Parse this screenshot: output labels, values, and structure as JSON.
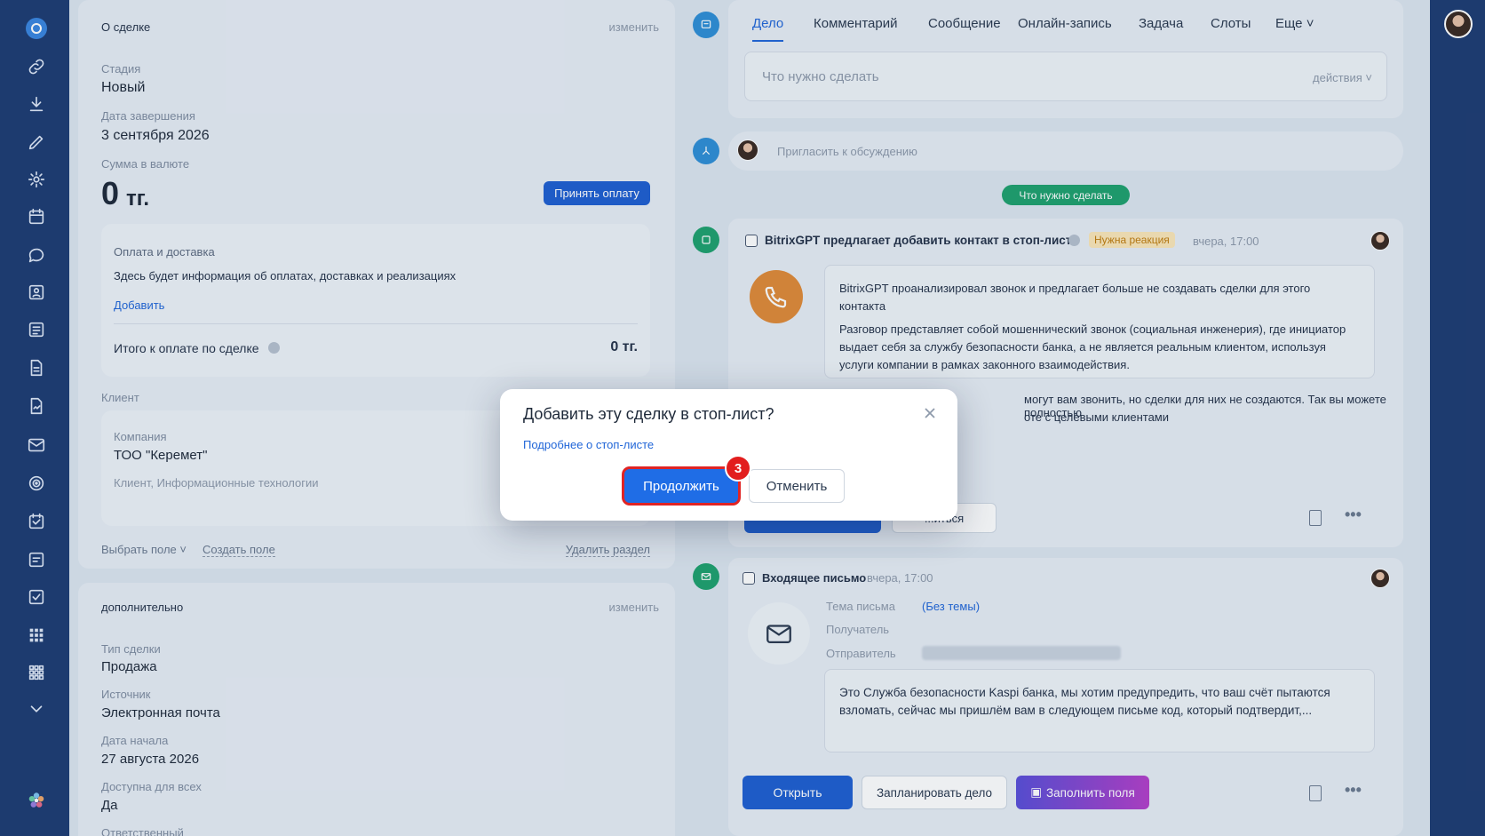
{
  "left": {
    "deal_header": "О сделке",
    "edit": "изменить",
    "stage_label": "Стадия",
    "stage_value": "Новый",
    "close_date_label": "Дата завершения",
    "close_date_value": "3 сентября 2026",
    "amount_label": "Сумма в валюте",
    "amount_value": "0",
    "amount_currency": "тг.",
    "accept_payment": "Принять оплату",
    "payment_title": "Оплата и доставка",
    "payment_desc": "Здесь будет информация об оплатах, доставках и реализациях",
    "add": "Добавить",
    "total_label": "Итого к оплате по сделке",
    "total_value": "0 тг.",
    "client_label": "Клиент",
    "company_label": "Компания",
    "company_value": "ТОО \"Керемет\"",
    "company_desc": "Клиент, Информационные технологии",
    "choose_field": "Выбрать поле",
    "create_field": "Создать поле",
    "delete_section": "Удалить раздел",
    "extra_header": "дополнительно",
    "extra_edit": "изменить",
    "deal_type_label": "Тип сделки",
    "deal_type_value": "Продажа",
    "source_label": "Источник",
    "source_value": "Электронная почта",
    "start_date_label": "Дата начала",
    "start_date_value": "27 августа 2026",
    "available_label": "Доступна для всех",
    "available_value": "Да",
    "responsible_label": "Ответственный"
  },
  "tabs": [
    "Дело",
    "Комментарий",
    "Сообщение",
    "Онлайн-запись",
    "Задача",
    "Слоты",
    "Еще"
  ],
  "todo": {
    "placeholder": "Что нужно сделать",
    "actions": "действия"
  },
  "invite": "Пригласить к обсуждению",
  "todo_pill": "Что нужно сделать",
  "gpt": {
    "title": "BitrixGPT предлагает добавить контакт в стоп-лист",
    "tag": "Нужна реакция",
    "time": "вчера, 17:00",
    "p1": "BitrixGPT проанализировал звонок и предлагает больше не создавать сделки для этого контакта",
    "p2": "Разговор представляет собой мошеннический звонок (социальная инженерия), где инициатор выдает себя за службу безопасности банка, а не является реальным клиентом, используя услуги компании в рамках законного взаимодействия.",
    "p3a": "могут вам звонить, но сделки для них не создаются. Так вы можете полностью",
    "p3b": "оте с целевыми клиентами",
    "btn2": "...иться"
  },
  "email": {
    "title": "Входящее письмо",
    "time": "вчера, 17:00",
    "subject_label": "Тема письма",
    "subject_value": "(Без темы)",
    "recipient_label": "Получатель",
    "sender_label": "Отправитель",
    "body": "Это Служба безопасности Kaspi банка, мы хотим предупредить, что ваш счёт пытаются взломать, сейчас мы пришлём вам в следующем письме код, который подтвердит,...",
    "open": "Открыть",
    "plan": "Запланировать дело",
    "fill": "Заполнить поля"
  },
  "modal": {
    "title": "Добавить эту сделку в стоп-лист?",
    "link": "Подробнее о стоп-листе",
    "continue": "Продолжить",
    "cancel": "Отменить",
    "step": "3"
  },
  "colors": {
    "accent": "#1f6de6",
    "highlight": "#e02424",
    "green": "#1fa16e"
  }
}
